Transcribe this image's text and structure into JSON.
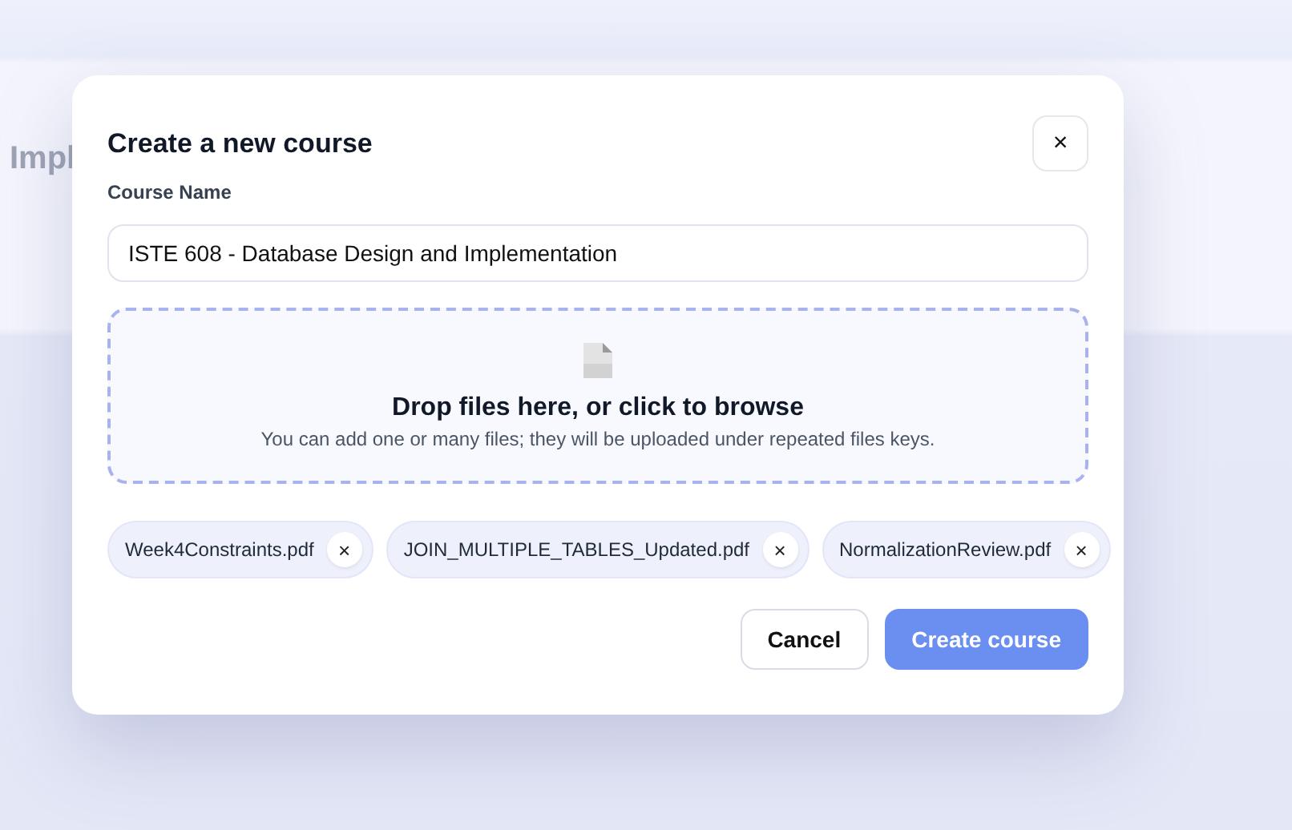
{
  "background": {
    "card_title": "Impl"
  },
  "dialog": {
    "title": "Create a new course",
    "close": "×",
    "field": {
      "label": "Course Name",
      "value": "ISTE 608 - Database Design and Implementation"
    },
    "dropzone": {
      "title": "Drop files here, or click to browse",
      "hint": "You can add one or many files; they will be uploaded under repeated files keys."
    },
    "files": [
      {
        "name": "Week4Constraints.pdf",
        "remove": "×"
      },
      {
        "name": "JOIN_MULTIPLE_TABLES_Updated.pdf",
        "remove": "×"
      },
      {
        "name": "NormalizationReview.pdf",
        "remove": "×"
      }
    ],
    "buttons": [
      {
        "kind": "secondary",
        "label": "Cancel"
      },
      {
        "kind": "primary",
        "label": "Create course"
      }
    ]
  }
}
